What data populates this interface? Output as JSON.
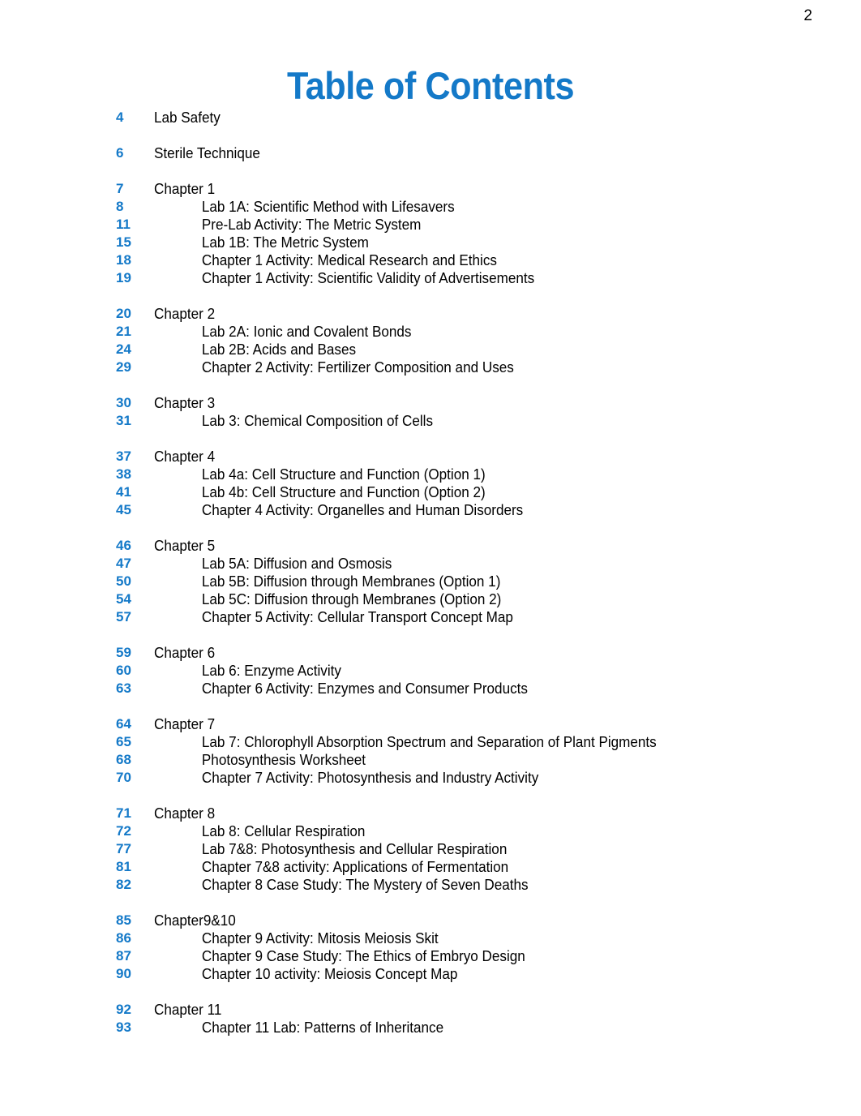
{
  "document": {
    "title": "Table of Contents",
    "folio": "2",
    "accent_color": "#1479C8",
    "text_color": "#000000",
    "background_color": "#ffffff"
  },
  "toc": {
    "groups": [
      {
        "entries": [
          {
            "page": "4",
            "label": "Lab Safety",
            "level": "top"
          }
        ]
      },
      {
        "entries": [
          {
            "page": "6",
            "label": "Sterile Technique",
            "level": "top"
          }
        ]
      },
      {
        "entries": [
          {
            "page": "7",
            "label": "Chapter 1",
            "level": "top"
          },
          {
            "page": "8",
            "label": "Lab 1A: Scientific Method with Lifesavers",
            "level": "sub"
          },
          {
            "page": "11",
            "label": "Pre-Lab Activity: The Metric System",
            "level": "sub"
          },
          {
            "page": "15",
            "label": "Lab 1B: The Metric System",
            "level": "sub"
          },
          {
            "page": "18",
            "label": "Chapter 1 Activity: Medical Research and Ethics",
            "level": "sub"
          },
          {
            "page": "19",
            "label": "Chapter 1 Activity: Scientific Validity of Advertisements",
            "level": "sub"
          }
        ]
      },
      {
        "entries": [
          {
            "page": "20",
            "label": "Chapter 2",
            "level": "top"
          },
          {
            "page": "21",
            "label": "Lab 2A: Ionic and Covalent Bonds",
            "level": "sub"
          },
          {
            "page": "24",
            "label": "Lab 2B: Acids and Bases",
            "level": "sub"
          },
          {
            "page": "29",
            "label": "Chapter 2 Activity: Fertilizer Composition and Uses",
            "level": "sub"
          }
        ]
      },
      {
        "entries": [
          {
            "page": "30",
            "label": "Chapter 3",
            "level": "top"
          },
          {
            "page": "31",
            "label": "Lab 3: Chemical Composition of Cells",
            "level": "sub"
          }
        ]
      },
      {
        "entries": [
          {
            "page": "37",
            "label": "Chapter 4",
            "level": "top"
          },
          {
            "page": "38",
            "label": "Lab 4a: Cell Structure and Function (Option 1)",
            "level": "sub"
          },
          {
            "page": "41",
            "label": "Lab 4b: Cell Structure and Function (Option 2)",
            "level": "sub"
          },
          {
            "page": "45",
            "label": "Chapter 4 Activity: Organelles and Human Disorders",
            "level": "sub"
          }
        ]
      },
      {
        "entries": [
          {
            "page": "46",
            "label": "Chapter 5",
            "level": "top"
          },
          {
            "page": "47",
            "label": "Lab 5A: Diffusion and Osmosis",
            "level": "sub"
          },
          {
            "page": "50",
            "label": "Lab 5B: Diffusion through Membranes (Option 1)",
            "level": "sub"
          },
          {
            "page": "54",
            "label": "Lab 5C: Diffusion through Membranes (Option 2)",
            "level": "sub"
          },
          {
            "page": "57",
            "label": "Chapter 5 Activity: Cellular Transport Concept Map",
            "level": "sub"
          }
        ]
      },
      {
        "entries": [
          {
            "page": "59",
            "label": "Chapter 6",
            "level": "top"
          },
          {
            "page": "60",
            "label": "Lab 6: Enzyme Activity",
            "level": "sub"
          },
          {
            "page": "63",
            "label": "Chapter 6 Activity: Enzymes and Consumer Products",
            "level": "sub"
          }
        ]
      },
      {
        "entries": [
          {
            "page": "64",
            "label": "Chapter 7",
            "level": "top"
          },
          {
            "page": "65",
            "label": "Lab 7: Chlorophyll Absorption Spectrum and Separation of Plant Pigments",
            "level": "sub"
          },
          {
            "page": "68",
            "label": "Photosynthesis Worksheet",
            "level": "sub"
          },
          {
            "page": "70",
            "label": "Chapter 7 Activity: Photosynthesis and Industry Activity",
            "level": "sub"
          }
        ]
      },
      {
        "entries": [
          {
            "page": "71",
            "label": "Chapter 8",
            "level": "top"
          },
          {
            "page": "72",
            "label": "Lab 8: Cellular Respiration",
            "level": "sub"
          },
          {
            "page": "77",
            "label": "Lab 7&8: Photosynthesis and Cellular Respiration",
            "level": "sub"
          },
          {
            "page": "81",
            "label": "Chapter 7&8 activity: Applications of Fermentation",
            "level": "sub"
          },
          {
            "page": "82",
            "label": "Chapter 8 Case Study: The Mystery of Seven Deaths",
            "level": "sub"
          }
        ]
      },
      {
        "entries": [
          {
            "page": "85",
            "label": "Chapter9&10",
            "level": "top"
          },
          {
            "page": "86",
            "label": "Chapter 9 Activity: Mitosis Meiosis Skit",
            "level": "sub"
          },
          {
            "page": "87",
            "label": "Chapter 9 Case Study: The Ethics of Embryo Design",
            "level": "sub"
          },
          {
            "page": "90",
            "label": "Chapter 10 activity: Meiosis Concept Map",
            "level": "sub"
          }
        ]
      },
      {
        "entries": [
          {
            "page": "92",
            "label": "Chapter 11",
            "level": "top"
          },
          {
            "page": "93",
            "label": "Chapter 11 Lab: Patterns of Inheritance",
            "level": "sub"
          }
        ]
      }
    ]
  }
}
